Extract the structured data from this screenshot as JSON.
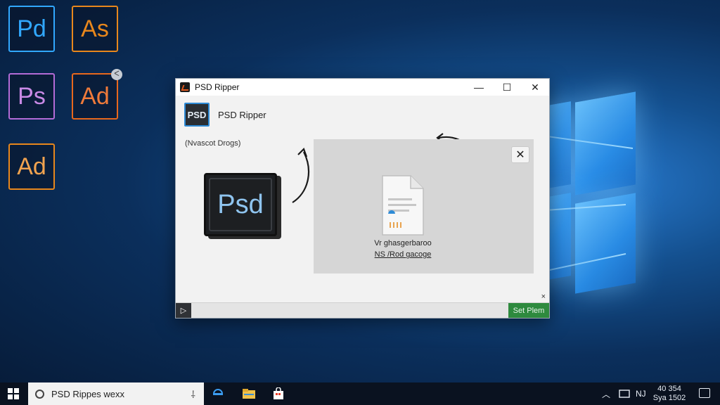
{
  "desktop": {
    "icons": [
      {
        "label": "Pd",
        "color": "#31a8ff"
      },
      {
        "label": "As",
        "color": "#e8871c"
      },
      {
        "label": "Ps",
        "color": "#b36bd6"
      },
      {
        "label": "Ad",
        "color": "#e8671c"
      },
      {
        "label": "Ad",
        "color": "#e8871c"
      }
    ],
    "badge_text": "ᐸ"
  },
  "window": {
    "title": "PSD Ripper",
    "minimize_glyph": "—",
    "maximize_glyph": "☐",
    "close_glyph": "✕",
    "header_badge": "PSD",
    "header_name": "PSD Ripper",
    "subtext": "(Nvascot Drogs)",
    "big_icon_text": "Psd",
    "dropzone": {
      "close_glyph": "✕",
      "line1": "Vr ghasgerbaroo",
      "line2": "NS /Rod gacoge"
    },
    "small_close": "×",
    "play_glyph": "▷",
    "set_button": "Set Plem"
  },
  "taskbar": {
    "search_text": "PSD Rippes wexx",
    "mic_glyph": "⸸",
    "tray_chevron": "︿",
    "tray_lang": "NJ",
    "clock_time": "40 354",
    "clock_date": "Sya 1502"
  },
  "colors": {
    "accent_blue": "#2e8bd6",
    "set_button_green": "#2e8a3e"
  }
}
